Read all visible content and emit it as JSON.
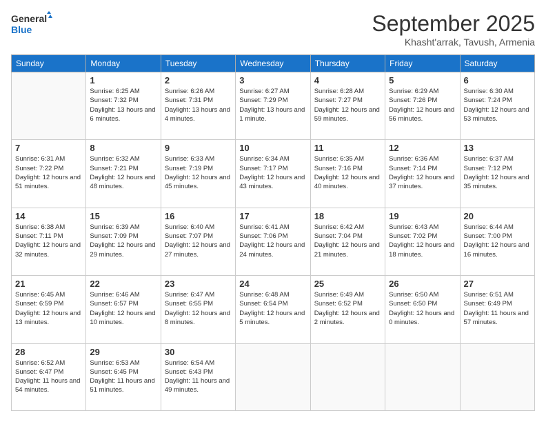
{
  "logo": {
    "line1": "General",
    "line2": "Blue"
  },
  "title": "September 2025",
  "subtitle": "Khasht'arrak, Tavush, Armenia",
  "days_of_week": [
    "Sunday",
    "Monday",
    "Tuesday",
    "Wednesday",
    "Thursday",
    "Friday",
    "Saturday"
  ],
  "weeks": [
    [
      null,
      {
        "day": "1",
        "sunrise": "6:25 AM",
        "sunset": "7:32 PM",
        "daylight": "13 hours and 6 minutes."
      },
      {
        "day": "2",
        "sunrise": "6:26 AM",
        "sunset": "7:31 PM",
        "daylight": "13 hours and 4 minutes."
      },
      {
        "day": "3",
        "sunrise": "6:27 AM",
        "sunset": "7:29 PM",
        "daylight": "13 hours and 1 minute."
      },
      {
        "day": "4",
        "sunrise": "6:28 AM",
        "sunset": "7:27 PM",
        "daylight": "12 hours and 59 minutes."
      },
      {
        "day": "5",
        "sunrise": "6:29 AM",
        "sunset": "7:26 PM",
        "daylight": "12 hours and 56 minutes."
      },
      {
        "day": "6",
        "sunrise": "6:30 AM",
        "sunset": "7:24 PM",
        "daylight": "12 hours and 53 minutes."
      }
    ],
    [
      {
        "day": "7",
        "sunrise": "6:31 AM",
        "sunset": "7:22 PM",
        "daylight": "12 hours and 51 minutes."
      },
      {
        "day": "8",
        "sunrise": "6:32 AM",
        "sunset": "7:21 PM",
        "daylight": "12 hours and 48 minutes."
      },
      {
        "day": "9",
        "sunrise": "6:33 AM",
        "sunset": "7:19 PM",
        "daylight": "12 hours and 45 minutes."
      },
      {
        "day": "10",
        "sunrise": "6:34 AM",
        "sunset": "7:17 PM",
        "daylight": "12 hours and 43 minutes."
      },
      {
        "day": "11",
        "sunrise": "6:35 AM",
        "sunset": "7:16 PM",
        "daylight": "12 hours and 40 minutes."
      },
      {
        "day": "12",
        "sunrise": "6:36 AM",
        "sunset": "7:14 PM",
        "daylight": "12 hours and 37 minutes."
      },
      {
        "day": "13",
        "sunrise": "6:37 AM",
        "sunset": "7:12 PM",
        "daylight": "12 hours and 35 minutes."
      }
    ],
    [
      {
        "day": "14",
        "sunrise": "6:38 AM",
        "sunset": "7:11 PM",
        "daylight": "12 hours and 32 minutes."
      },
      {
        "day": "15",
        "sunrise": "6:39 AM",
        "sunset": "7:09 PM",
        "daylight": "12 hours and 29 minutes."
      },
      {
        "day": "16",
        "sunrise": "6:40 AM",
        "sunset": "7:07 PM",
        "daylight": "12 hours and 27 minutes."
      },
      {
        "day": "17",
        "sunrise": "6:41 AM",
        "sunset": "7:06 PM",
        "daylight": "12 hours and 24 minutes."
      },
      {
        "day": "18",
        "sunrise": "6:42 AM",
        "sunset": "7:04 PM",
        "daylight": "12 hours and 21 minutes."
      },
      {
        "day": "19",
        "sunrise": "6:43 AM",
        "sunset": "7:02 PM",
        "daylight": "12 hours and 18 minutes."
      },
      {
        "day": "20",
        "sunrise": "6:44 AM",
        "sunset": "7:00 PM",
        "daylight": "12 hours and 16 minutes."
      }
    ],
    [
      {
        "day": "21",
        "sunrise": "6:45 AM",
        "sunset": "6:59 PM",
        "daylight": "12 hours and 13 minutes."
      },
      {
        "day": "22",
        "sunrise": "6:46 AM",
        "sunset": "6:57 PM",
        "daylight": "12 hours and 10 minutes."
      },
      {
        "day": "23",
        "sunrise": "6:47 AM",
        "sunset": "6:55 PM",
        "daylight": "12 hours and 8 minutes."
      },
      {
        "day": "24",
        "sunrise": "6:48 AM",
        "sunset": "6:54 PM",
        "daylight": "12 hours and 5 minutes."
      },
      {
        "day": "25",
        "sunrise": "6:49 AM",
        "sunset": "6:52 PM",
        "daylight": "12 hours and 2 minutes."
      },
      {
        "day": "26",
        "sunrise": "6:50 AM",
        "sunset": "6:50 PM",
        "daylight": "12 hours and 0 minutes."
      },
      {
        "day": "27",
        "sunrise": "6:51 AM",
        "sunset": "6:49 PM",
        "daylight": "11 hours and 57 minutes."
      }
    ],
    [
      {
        "day": "28",
        "sunrise": "6:52 AM",
        "sunset": "6:47 PM",
        "daylight": "11 hours and 54 minutes."
      },
      {
        "day": "29",
        "sunrise": "6:53 AM",
        "sunset": "6:45 PM",
        "daylight": "11 hours and 51 minutes."
      },
      {
        "day": "30",
        "sunrise": "6:54 AM",
        "sunset": "6:43 PM",
        "daylight": "11 hours and 49 minutes."
      },
      null,
      null,
      null,
      null
    ]
  ]
}
